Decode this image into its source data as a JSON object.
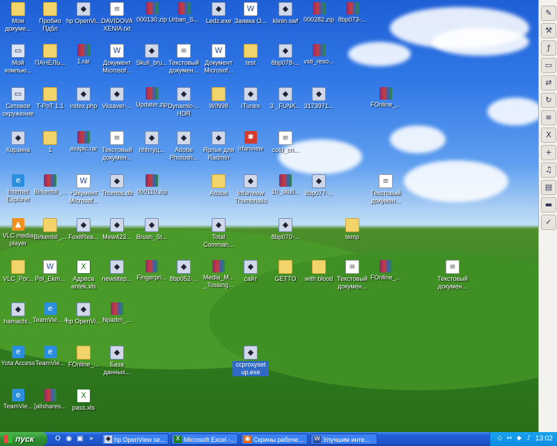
{
  "desktop": {
    "icons": [
      {
        "label": "Мои докуме...",
        "glyph": "folder"
      },
      {
        "label": "Пробио Пдбл",
        "glyph": "folder"
      },
      {
        "label": "hp OpenVi...",
        "glyph": "app"
      },
      {
        "label": "DAVIDOVA XENIA.txt",
        "glyph": "txt"
      },
      {
        "label": "000130.zip",
        "glyph": "rar"
      },
      {
        "label": "Urban_S...",
        "glyph": "rar"
      },
      {
        "label": "Ledz.exe",
        "glyph": "app"
      },
      {
        "label": "Заявка О...",
        "glyph": "doc"
      },
      {
        "label": "klinin.swf",
        "glyph": "app"
      },
      {
        "label": "000282.zip",
        "glyph": "rar"
      },
      {
        "label": "8bp073-...",
        "glyph": "rar"
      },
      {
        "label": "Мой компью...",
        "glyph": "pc"
      },
      {
        "label": "ПАНЕЛЬ...",
        "glyph": "folder"
      },
      {
        "label": "1.rar",
        "glyph": "rar"
      },
      {
        "label": "Документ Microsof...",
        "glyph": "doc"
      },
      {
        "label": "Skull_bru...",
        "glyph": "app"
      },
      {
        "label": "Текстовый докумен...",
        "glyph": "txt"
      },
      {
        "label": "Документ Microsof...",
        "glyph": "doc"
      },
      {
        "label": "test",
        "glyph": "folder"
      },
      {
        "label": "8bp078-...",
        "glyph": "app"
      },
      {
        "label": "vsti_reso...",
        "glyph": "rar"
      },
      {
        "label": "Сетевое окружение",
        "glyph": "pc"
      },
      {
        "label": "T-PoT 1.1",
        "glyph": "folder"
      },
      {
        "label": "index.php",
        "glyph": "app"
      },
      {
        "label": "Vksaver-...",
        "glyph": "app"
      },
      {
        "label": "Updater.zip",
        "glyph": "rar"
      },
      {
        "label": "Dynamic-... HDR",
        "glyph": "app"
      },
      {
        "label": "WIN98",
        "glyph": "folder"
      },
      {
        "label": "iTunes",
        "glyph": "app"
      },
      {
        "label": "3._FUNK...",
        "glyph": "app"
      },
      {
        "label": "3173971...",
        "glyph": "app"
      },
      {
        "label": "FOnline_...",
        "glyph": "rar"
      },
      {
        "label": "Корзина",
        "glyph": "app"
      },
      {
        "label": "1",
        "glyph": "folder"
      },
      {
        "label": "avapic.rar",
        "glyph": "rar"
      },
      {
        "label": "Текстовый докумен...",
        "glyph": "txt"
      },
      {
        "label": "hhhтуц...",
        "glyph": "app"
      },
      {
        "label": "Adobe Photosh...",
        "glyph": "app"
      },
      {
        "label": "Ярлык для Radmin",
        "glyph": "app"
      },
      {
        "label": "Irfanview",
        "glyph": "red"
      },
      {
        "label": "cold_cri...",
        "glyph": "txt"
      },
      {
        "label": "Internet Explorer",
        "glyph": "blue"
      },
      {
        "label": "Birkenbil_...",
        "glyph": "rar"
      },
      {
        "label": "+Экумент Microsof...",
        "glyph": "doc"
      },
      {
        "label": "Thumbs.db",
        "glyph": "app"
      },
      {
        "label": "000110.zip",
        "glyph": "rar"
      },
      {
        "label": "Adobe",
        "glyph": "folder"
      },
      {
        "label": "Infanview Thumbnails",
        "glyph": "app"
      },
      {
        "label": "10_skull...",
        "glyph": "rar"
      },
      {
        "label": "8bp077-...",
        "glyph": "app"
      },
      {
        "label": "Текстовый докумен...",
        "glyph": "txt"
      },
      {
        "label": "VLC media player",
        "glyph": "orange"
      },
      {
        "label": "Birkenbil_...",
        "glyph": "folder"
      },
      {
        "label": "FoxitRea...",
        "glyph": "app"
      },
      {
        "label": "Mew423...",
        "glyph": "app"
      },
      {
        "label": "Brush_St...",
        "glyph": "app"
      },
      {
        "label": "Total Comman...",
        "glyph": "app"
      },
      {
        "label": "8bp070-...",
        "glyph": "app"
      },
      {
        "label": "temp",
        "glyph": "folder"
      },
      {
        "label": "VLC_Por...",
        "glyph": "folder"
      },
      {
        "label": "Pol_Ekm...",
        "glyph": "doc"
      },
      {
        "label": "Адреса antek.xls",
        "glyph": "xls"
      },
      {
        "label": "newsitep...",
        "glyph": "app"
      },
      {
        "label": "Fingerpri...",
        "glyph": "rar"
      },
      {
        "label": "8bp052-...",
        "glyph": "app"
      },
      {
        "label": "Media_M... _Tossing...",
        "glyph": "rar"
      },
      {
        "label": "сайт",
        "glyph": "app"
      },
      {
        "label": "GETTO",
        "glyph": "folder"
      },
      {
        "label": "with blood",
        "glyph": "folder"
      },
      {
        "label": "Текстовый докумен...",
        "glyph": "txt"
      },
      {
        "label": "FOnline_...",
        "glyph": "rar"
      },
      {
        "label": "Текстовый докумен...",
        "glyph": "txt"
      },
      {
        "label": "hamachi...",
        "glyph": "app"
      },
      {
        "label": "TeamVie... 4",
        "glyph": "blue"
      },
      {
        "label": "hp OpenVi...",
        "glyph": "app"
      },
      {
        "label": "Npadm_...",
        "glyph": "rar"
      },
      {
        "label": "Yota Access",
        "glyph": "blue"
      },
      {
        "label": "TeamVie...",
        "glyph": "blue"
      },
      {
        "label": "FOnline_...",
        "glyph": "folder"
      },
      {
        "label": "База данных...",
        "glyph": "app"
      },
      {
        "label": "ccproxyset up.exe",
        "glyph": "app"
      },
      {
        "label": "TeamVie...",
        "glyph": "blue"
      },
      {
        "label": "[allshares...",
        "glyph": "rar"
      },
      {
        "label": "pass.xls",
        "glyph": "xls"
      }
    ]
  },
  "sidebar": {
    "buttons": [
      "notepad-icon",
      "tools-icon",
      "flash-icon",
      "window-icon",
      "network-icon",
      "refresh-icon",
      "list-icon",
      "excel-icon",
      "add-icon",
      "winamp-icon",
      "folder-icon",
      "drive-icon",
      "check-icon"
    ]
  },
  "taskbar": {
    "start_label": "пуск",
    "tasks": [
      {
        "label": "hp OpenView se...",
        "icon": "app"
      },
      {
        "label": "Microsoft Excel -...",
        "icon": "xls"
      },
      {
        "label": "Скрины рабоче...",
        "icon": "firefox"
      },
      {
        "label": "Улучшим инте...",
        "icon": "doc"
      }
    ],
    "clock": "13:02"
  }
}
